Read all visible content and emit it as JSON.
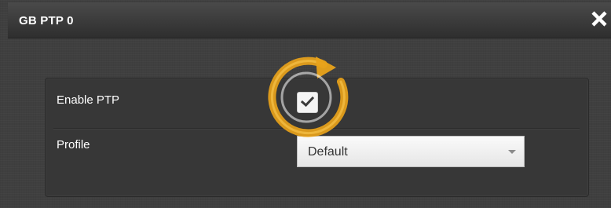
{
  "dialog": {
    "title": "GB PTP 0",
    "close_icon": "close-icon"
  },
  "form": {
    "enable_ptp": {
      "label": "Enable PTP",
      "checked": true
    },
    "profile": {
      "label": "Profile",
      "selected": "Default"
    }
  },
  "colors": {
    "highlight": "#e8a21a",
    "title_bar": "#383838",
    "panel": "#373737"
  }
}
